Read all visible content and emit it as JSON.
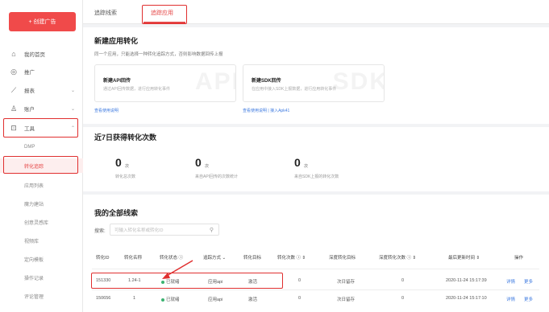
{
  "sidebar": {
    "create_button": "+ 创建广告",
    "items": [
      {
        "label": "我的首页",
        "icon": "home-icon"
      },
      {
        "label": "推广",
        "icon": "target-icon"
      },
      {
        "label": "报表",
        "icon": "chart-icon",
        "chevron": "⌄"
      },
      {
        "label": "账户",
        "icon": "user-icon",
        "chevron": "⌄"
      },
      {
        "label": "工具",
        "icon": "toolbox-icon",
        "chevron": "⌃"
      }
    ],
    "subitems": [
      "DMP",
      "转化追踪",
      "应用列表",
      "魔力建站",
      "创意灵感库",
      "视频库",
      "定向模板",
      "操作记录",
      "评论管理"
    ]
  },
  "tabs": [
    "追踪线索",
    "追踪应用"
  ],
  "new_conversion": {
    "title": "新建应用转化",
    "desc": "同一个应用，只能选择一种转化追踪方式，否则影响数据回传上报",
    "cards": [
      {
        "title": "新建API回传",
        "desc": "通过API回传数据，进行应用转化事件",
        "watermark": "API",
        "link": "查看使用说明"
      },
      {
        "title": "新建SDK回传",
        "desc": "在应用中接入SDK上报数据，进行应用转化事件",
        "watermark": "SDK",
        "link": "查看使用说明 | 接入Apk41"
      }
    ]
  },
  "stats": {
    "title": "近7日获得转化次数",
    "items": [
      {
        "value": "0",
        "unit": "次",
        "label": "转化总次数"
      },
      {
        "value": "0",
        "unit": "次",
        "label": "来自API回传的次数统计"
      },
      {
        "value": "0",
        "unit": "次",
        "label": "来自SDK上报的转化次数"
      }
    ]
  },
  "list": {
    "title": "我的全部线索",
    "search_label": "搜索:",
    "search_placeholder": "可输入转化名称或转化ID",
    "search_icon": "magnifier-icon",
    "columns": [
      "转化ID",
      "转化名称",
      "转化状态 ⓘ",
      "追踪方式 ⌄",
      "转化目标",
      "转化次数 ⓘ ⇕",
      "深度转化目标",
      "深度转化次数 ⓘ ⇕",
      "最后更新时间 ⇕",
      "操作"
    ],
    "rows": [
      {
        "id": "151330",
        "name": "1.24-1",
        "status": "已就绪",
        "method": "应用api",
        "target": "激活",
        "count": "0",
        "deep_target": "次日留存",
        "deep_count": "0",
        "updated": "2020-11-24 15:17:39",
        "op1": "详情",
        "op2": "更多"
      },
      {
        "id": "150656",
        "name": "1",
        "status": "已就绪",
        "method": "应用api",
        "target": "激活",
        "count": "0",
        "deep_target": "次日留存",
        "deep_count": "0",
        "updated": "2020-11-24 15:17:10",
        "op1": "详情",
        "op2": "更多"
      }
    ]
  },
  "colors": {
    "accent": "#e54545",
    "link": "#3f7be0",
    "status_ok": "#3cb371",
    "annotation": "#e02f2f"
  }
}
